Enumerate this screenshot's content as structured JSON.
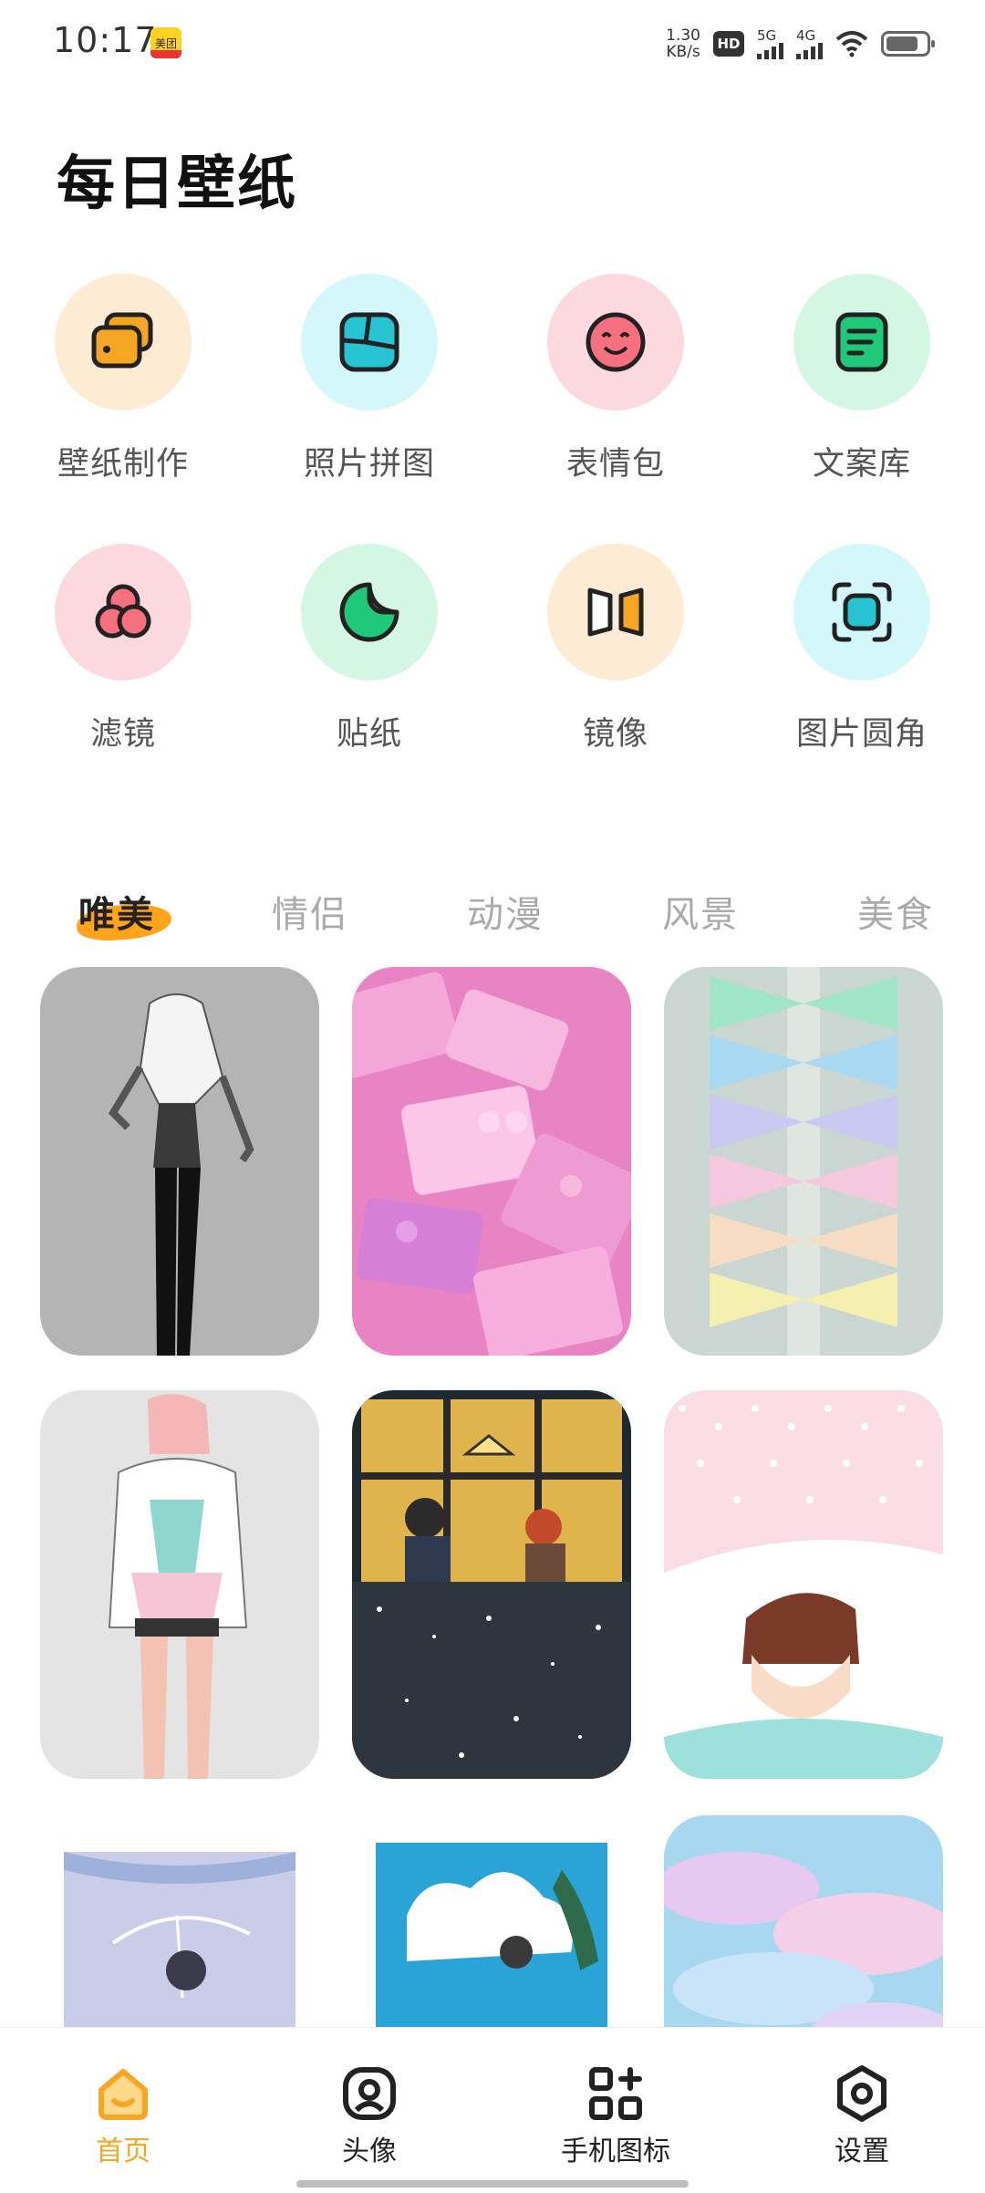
{
  "status_bar": {
    "time": "10:17",
    "app_badge": "美团",
    "net_speed_value": "1.30",
    "net_speed_unit": "KB/s",
    "hd": "HD",
    "sim1": "5G",
    "sim2": "4G"
  },
  "title": "每日壁纸",
  "tools": [
    {
      "label": "壁纸制作",
      "icon": "wallet-cards-icon",
      "bg": "#fdebd3",
      "color": "#f5a623"
    },
    {
      "label": "照片拼图",
      "icon": "collage-icon",
      "bg": "#d3f7fb",
      "color": "#26c3d3"
    },
    {
      "label": "表情包",
      "icon": "smiley-icon",
      "bg": "#fcd9de",
      "color": "#f7707f"
    },
    {
      "label": "文案库",
      "icon": "document-icon",
      "bg": "#d3f7e2",
      "color": "#20c97a"
    },
    {
      "label": "滤镜",
      "icon": "filter-circles-icon",
      "bg": "#fcd9de",
      "color": "#f7707f"
    },
    {
      "label": "贴纸",
      "icon": "sticker-icon",
      "bg": "#d3f7e2",
      "color": "#20c97a"
    },
    {
      "label": "镜像",
      "icon": "mirror-icon",
      "bg": "#fdebd3",
      "color": "#f5a623"
    },
    {
      "label": "图片圆角",
      "icon": "rounded-corner-icon",
      "bg": "#d3f7fb",
      "color": "#26c3d3"
    }
  ],
  "tabs": [
    "唯美",
    "情侣",
    "动漫",
    "风景",
    "美食"
  ],
  "active_tab": "唯美",
  "accent_color": "#f5a623",
  "nav": [
    {
      "label": "首页",
      "icon": "home-icon",
      "active": true
    },
    {
      "label": "头像",
      "icon": "avatar-icon",
      "active": false
    },
    {
      "label": "手机图标",
      "icon": "apps-icon",
      "active": false
    },
    {
      "label": "设置",
      "icon": "settings-icon",
      "active": false
    }
  ]
}
